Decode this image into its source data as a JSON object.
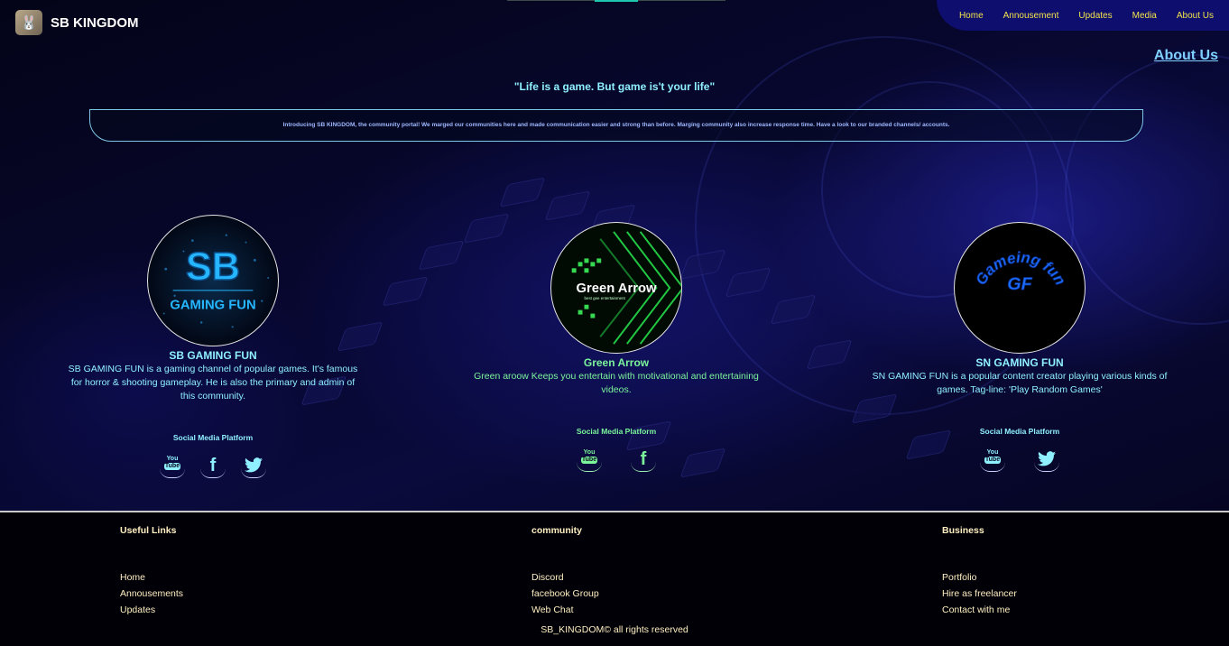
{
  "header": {
    "brand": "SB KINGDOM",
    "nav": [
      "Home",
      "Annousement",
      "Updates",
      "Media",
      "About Us"
    ]
  },
  "about": {
    "heading": "About Us",
    "tagline": "\"Life is a game. But game is't your life\"",
    "intro": "Introducing SB KINGDOM, the community portal! We marged our communities here and made communication easier and strong than before. Marging community also increase response time. Have a look to our branded channels/ accounts."
  },
  "channels": [
    {
      "title": "SB GAMING FUN",
      "logo_text": [
        "SB",
        "GAMING FUN"
      ],
      "description": "SB GAMING FUN is a gaming channel of popular games. It's famous for horror & shooting gameplay. He is also the primary and admin of this community.",
      "social_label": "Social Media Platform",
      "icons": [
        "youtube-icon",
        "facebook-icon",
        "twitter-icon"
      ],
      "color": "#8ff0ff"
    },
    {
      "title": "Green Arrow",
      "logo_text": [
        "Green Arrow",
        "best gee entertainment"
      ],
      "description": "Green aroow Keeps you entertain with motivational and entertaining videos.",
      "social_label": "Social Media Platform",
      "icons": [
        "youtube-icon",
        "facebook-icon"
      ],
      "color": "#7bf59a"
    },
    {
      "title": "SN GAMING FUN",
      "logo_text": [
        "Gameing fun",
        "GF"
      ],
      "description": "SN GAMING FUN is a popular content creator playing various kinds of games. Tag-line: 'Play Random Games'",
      "social_label": "Social Media Platform",
      "icons": [
        "youtube-icon",
        "twitter-icon"
      ],
      "color": "#8ff0ff"
    }
  ],
  "icon_glyphs": {
    "youtube_top": "You",
    "youtube_bottom": "Tube",
    "facebook": "f",
    "twitter": "🐦"
  },
  "footer": {
    "columns": [
      {
        "title": "Useful Links",
        "links": [
          "Home",
          "Annousements",
          "Updates"
        ]
      },
      {
        "title": "community",
        "links": [
          "Discord",
          "facebook Group",
          "Web Chat"
        ]
      },
      {
        "title": "Business",
        "links": [
          "Portfolio",
          "Hire as freelancer",
          "Contact with me"
        ]
      }
    ],
    "copyright": "SB_KINGDOM© all rights reserved"
  },
  "colors": {
    "nav_bg": "#0e0e6e",
    "nav_text": "#f1e34a",
    "accent_cyan": "#8ff0ff",
    "accent_green": "#7bf59a",
    "footer_text": "#ffeec2"
  }
}
